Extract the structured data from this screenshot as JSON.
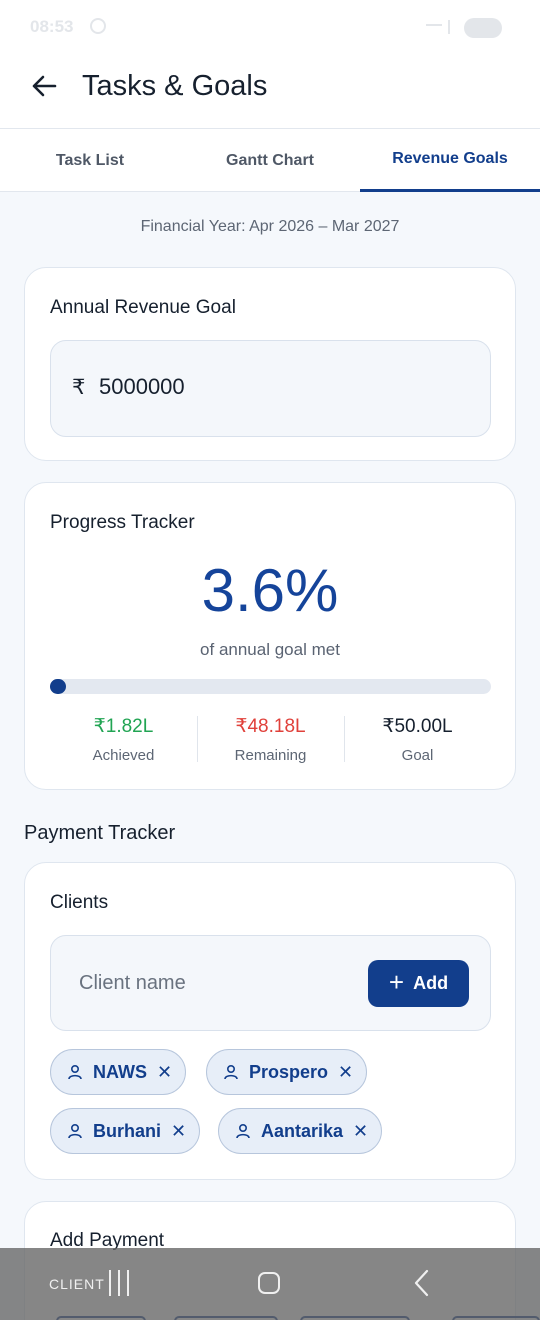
{
  "status_bar": {
    "time": "08:53"
  },
  "app_bar": {
    "title": "Tasks & Goals",
    "back_icon": "arrow-left-icon"
  },
  "tabs": [
    {
      "label": "Task List",
      "active": false
    },
    {
      "label": "Gantt Chart",
      "active": false
    },
    {
      "label": "Revenue Goals",
      "active": true
    }
  ],
  "financial_year": "Financial Year: Apr 2026 – Mar 2027",
  "annual_goal": {
    "title": "Annual Revenue Goal",
    "currency_symbol": "₹",
    "value": "5000000"
  },
  "progress": {
    "title": "Progress Tracker",
    "percent_text": "3.6%",
    "subtitle": "of annual goal met",
    "fill_fraction": 0.036,
    "stats": [
      {
        "value": "₹1.82L",
        "label": "Achieved",
        "color": "#21a453"
      },
      {
        "value": "₹48.18L",
        "label": "Remaining",
        "color": "#e0403a"
      },
      {
        "value": "₹50.00L",
        "label": "Goal",
        "color": "#16202e"
      }
    ]
  },
  "payment_tracker": {
    "section_title": "Payment Tracker",
    "clients": {
      "title": "Clients",
      "input_placeholder": "Client name",
      "add_button_label": "Add",
      "chips": [
        "NAWS",
        "Prospero",
        "Burhani",
        "Aantarika"
      ]
    },
    "add_payment": {
      "title": "Add Payment"
    }
  },
  "nav_bar": {
    "overlay_label": "CLIENT"
  },
  "colors": {
    "primary": "#123e8c",
    "achieved": "#21a453",
    "remaining": "#e0403a"
  }
}
